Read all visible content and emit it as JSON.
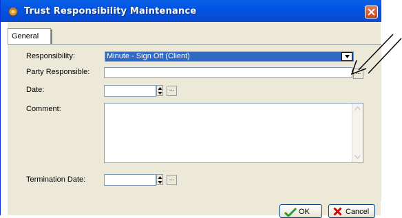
{
  "window": {
    "title": "Trust Responsibility Maintenance"
  },
  "tabs": [
    {
      "label": "General",
      "selected": true
    }
  ],
  "form": {
    "responsibility": {
      "label": "Responsibility:",
      "value": "Minute - Sign Off (Client)"
    },
    "party_responsible": {
      "label": "Party Responsible:",
      "value": ""
    },
    "date": {
      "label": "Date:",
      "value": ""
    },
    "comment": {
      "label": "Comment:",
      "value": ""
    },
    "termination_date": {
      "label": "Termination Date:",
      "value": ""
    }
  },
  "buttons": {
    "ellipsis": "...",
    "ok": "OK",
    "cancel": "Cancel"
  },
  "colors": {
    "titlebar": "#0054e3",
    "selection": "#316ac5",
    "close": "#c94224",
    "ok_icon": "#2e9a2e",
    "cancel_icon": "#cc0000"
  }
}
